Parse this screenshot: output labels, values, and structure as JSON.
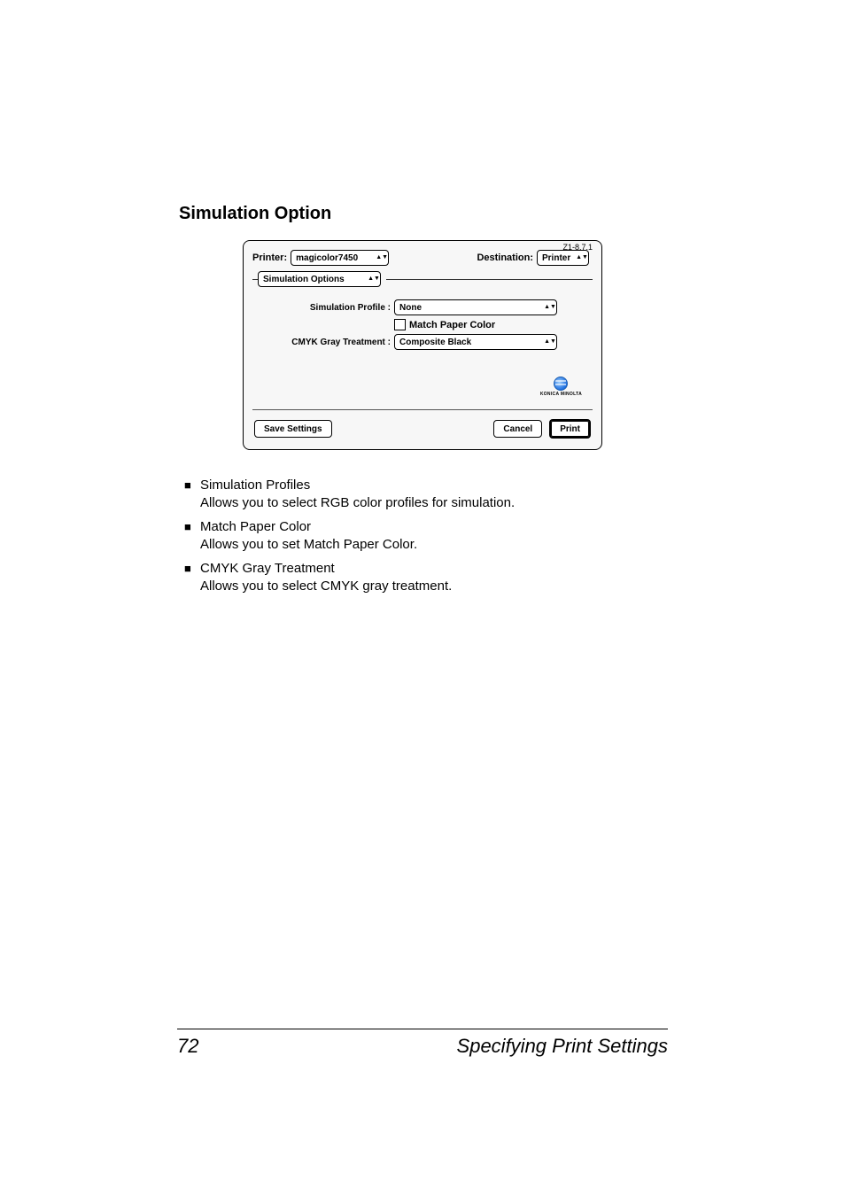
{
  "section_title": "Simulation Option",
  "dialog": {
    "version": "Z1-8.7.1",
    "printer_label": "Printer:",
    "printer_value": "magicolor7450",
    "destination_label": "Destination:",
    "destination_value": "Printer",
    "section_value": "Simulation Options",
    "sim_profile_label": "Simulation Profile :",
    "sim_profile_value": "None",
    "match_paper_label": "Match Paper Color",
    "cmyk_label": "CMYK Gray Treatment :",
    "cmyk_value": "Composite Black",
    "logo_text": "KONICA MINOLTA",
    "save_label": "Save Settings",
    "cancel_label": "Cancel",
    "print_label": "Print"
  },
  "items": [
    {
      "label": "Simulation Profiles",
      "desc": "Allows you to select RGB color profiles for simulation."
    },
    {
      "label": "Match Paper Color",
      "desc": "Allows you to set Match Paper Color."
    },
    {
      "label": "CMYK Gray Treatment",
      "desc": "Allows you to select CMYK gray treatment."
    }
  ],
  "footer": {
    "page": "72",
    "title": "Specifying Print Settings"
  }
}
